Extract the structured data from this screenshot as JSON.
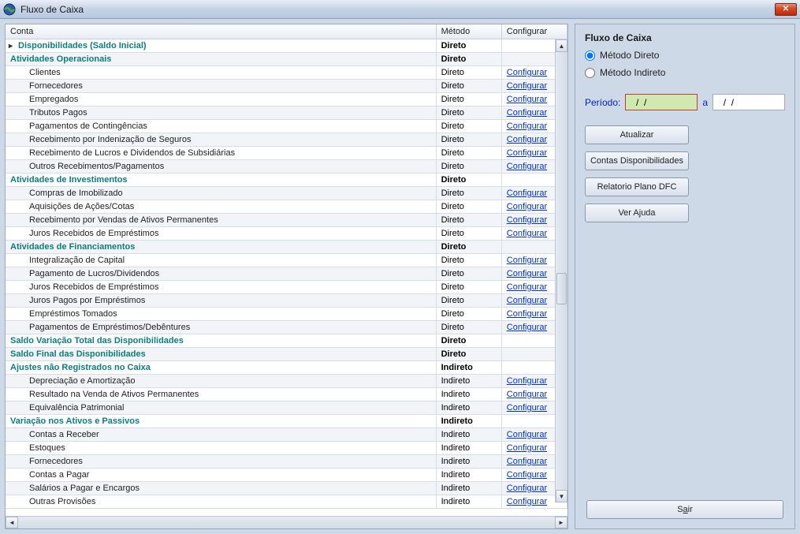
{
  "window": {
    "title": "Fluxo de Caixa"
  },
  "table": {
    "headers": {
      "conta": "Conta",
      "metodo": "Método",
      "config": "Configurar"
    },
    "configurar_label": "Configurar",
    "rows": [
      {
        "type": "section",
        "conta": "Disponibilidades (Saldo Inicial)",
        "metodo": "Direto",
        "config": false,
        "expand": true
      },
      {
        "type": "section",
        "conta": "Atividades Operacionais",
        "metodo": "Direto",
        "config": false
      },
      {
        "type": "child",
        "conta": "Clientes",
        "metodo": "Direto",
        "config": true
      },
      {
        "type": "child",
        "conta": "Fornecedores",
        "metodo": "Direto",
        "config": true
      },
      {
        "type": "child",
        "conta": "Empregados",
        "metodo": "Direto",
        "config": true
      },
      {
        "type": "child",
        "conta": "Tributos Pagos",
        "metodo": "Direto",
        "config": true
      },
      {
        "type": "child",
        "conta": "Pagamentos de Contingências",
        "metodo": "Direto",
        "config": true
      },
      {
        "type": "child",
        "conta": "Recebimento por Indenização de Seguros",
        "metodo": "Direto",
        "config": true
      },
      {
        "type": "child",
        "conta": "Recebimento de Lucros e Dividendos de Subsidiárias",
        "metodo": "Direto",
        "config": true
      },
      {
        "type": "child",
        "conta": "Outros Recebimentos/Pagamentos",
        "metodo": "Direto",
        "config": true
      },
      {
        "type": "section",
        "conta": "Atividades de Investimentos",
        "metodo": "Direto",
        "config": false
      },
      {
        "type": "child",
        "conta": "Compras de Imobilizado",
        "metodo": "Direto",
        "config": true
      },
      {
        "type": "child",
        "conta": "Aquisições de Ações/Cotas",
        "metodo": "Direto",
        "config": true
      },
      {
        "type": "child",
        "conta": "Recebimento por Vendas de Ativos Permanentes",
        "metodo": "Direto",
        "config": true
      },
      {
        "type": "child",
        "conta": "Juros Recebidos de Empréstimos",
        "metodo": "Direto",
        "config": true
      },
      {
        "type": "section",
        "conta": "Atividades de Financiamentos",
        "metodo": "Direto",
        "config": false
      },
      {
        "type": "child",
        "conta": "Integralização de Capital",
        "metodo": "Direto",
        "config": true
      },
      {
        "type": "child",
        "conta": "Pagamento de Lucros/Dividendos",
        "metodo": "Direto",
        "config": true
      },
      {
        "type": "child",
        "conta": "Juros Recebidos de Empréstimos",
        "metodo": "Direto",
        "config": true
      },
      {
        "type": "child",
        "conta": "Juros Pagos por Empréstimos",
        "metodo": "Direto",
        "config": true
      },
      {
        "type": "child",
        "conta": "Empréstimos Tomados",
        "metodo": "Direto",
        "config": true
      },
      {
        "type": "child",
        "conta": "Pagamentos de Empréstimos/Debêntures",
        "metodo": "Direto",
        "config": true
      },
      {
        "type": "section",
        "conta": "Saldo Variação Total das Disponibilidades",
        "metodo": "Direto",
        "config": false
      },
      {
        "type": "section",
        "conta": "Saldo Final das Disponibilidades",
        "metodo": "Direto",
        "config": false
      },
      {
        "type": "section",
        "conta": "Ajustes não Registrados no Caixa",
        "metodo": "Indireto",
        "config": false
      },
      {
        "type": "child",
        "conta": "Depreciação e Amortização",
        "metodo": "Indireto",
        "config": true
      },
      {
        "type": "child",
        "conta": "Resultado na Venda de Ativos Permanentes",
        "metodo": "Indireto",
        "config": true
      },
      {
        "type": "child",
        "conta": "Equivalência Patrimonial",
        "metodo": "Indireto",
        "config": true
      },
      {
        "type": "section",
        "conta": "Variação nos Ativos e Passivos",
        "metodo": "Indireto",
        "config": false
      },
      {
        "type": "child",
        "conta": "Contas a Receber",
        "metodo": "Indireto",
        "config": true
      },
      {
        "type": "child",
        "conta": "Estoques",
        "metodo": "Indireto",
        "config": true
      },
      {
        "type": "child",
        "conta": "Fornecedores",
        "metodo": "Indireto",
        "config": true
      },
      {
        "type": "child",
        "conta": "Contas a Pagar",
        "metodo": "Indireto",
        "config": true
      },
      {
        "type": "child",
        "conta": "Salários a Pagar e Encargos",
        "metodo": "Indireto",
        "config": true
      },
      {
        "type": "child",
        "conta": "Outras Provisões",
        "metodo": "Indireto",
        "config": true
      }
    ]
  },
  "sidebar": {
    "group_title": "Fluxo de Caixa",
    "radio_direto": "Método Direto",
    "radio_indireto": "Método Indireto",
    "radio_selected": "direto",
    "periodo_label": "Período:",
    "periodo_sep": "a",
    "date_start": "  /  /",
    "date_end": "  /  /",
    "btn_atualizar": "Atualizar",
    "btn_contas": "Contas Disponibilidades",
    "btn_relatorio": "Relatorio Plano DFC",
    "btn_ajuda": "Ver Ajuda",
    "btn_sair_pre": "S",
    "btn_sair_u": "a",
    "btn_sair_post": "ir"
  }
}
